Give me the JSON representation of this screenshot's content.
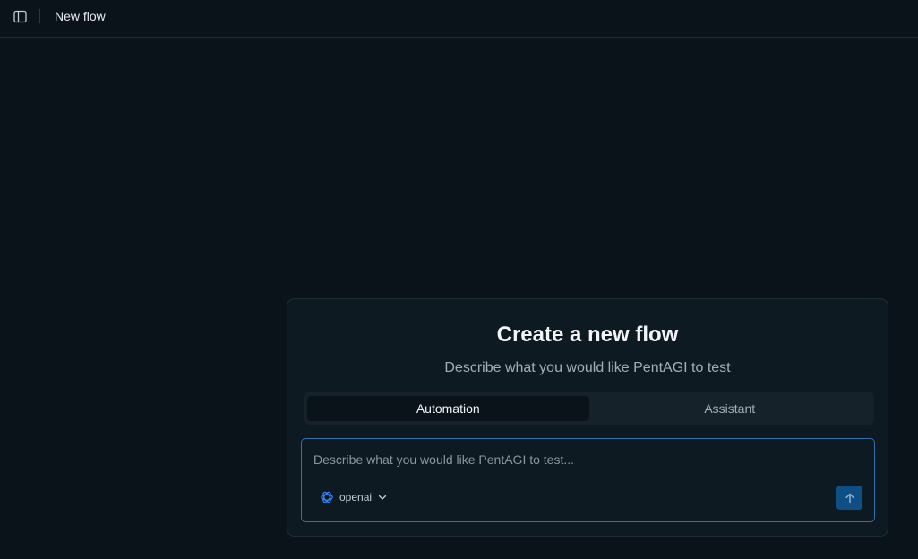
{
  "header": {
    "title": "New flow",
    "sidebar_toggle_icon": "sidebar-panel-icon"
  },
  "card": {
    "title": "Create a new flow",
    "subtitle": "Describe what you would like PentAGI to test"
  },
  "tabs": [
    {
      "label": "Automation",
      "active": true
    },
    {
      "label": "Assistant",
      "active": false
    }
  ],
  "composer": {
    "placeholder": "Describe what you would like PentAGI to test...",
    "provider": {
      "label": "openai",
      "icon": "openai-icon"
    },
    "send_icon": "arrow-up-icon"
  },
  "colors": {
    "background": "#0a1319",
    "card": "#0e1a21",
    "accent_border": "#2f6fb0",
    "send_button": "#0e4f86",
    "provider_icon": "#3b82f6"
  }
}
